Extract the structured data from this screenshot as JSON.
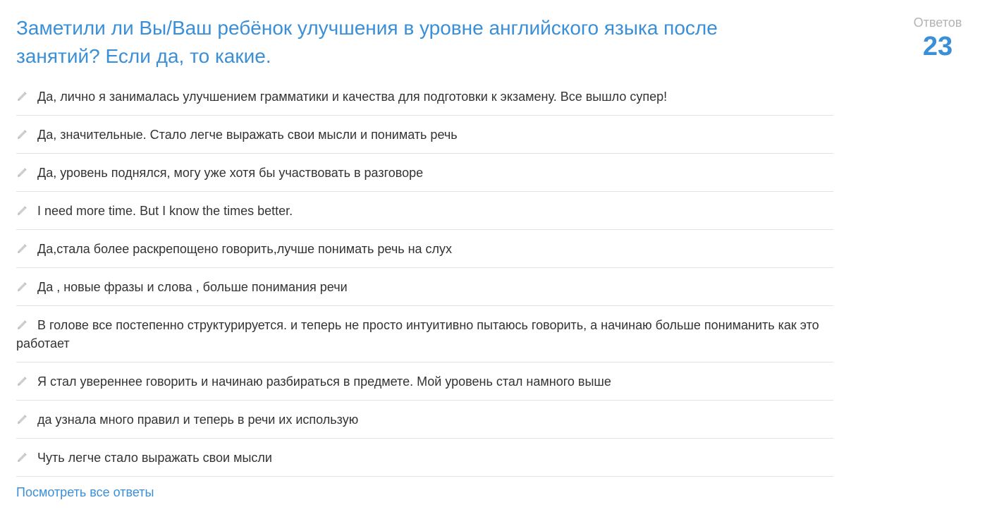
{
  "question": {
    "title": "Заметили ли Вы/Ваш ребёнок улучшения в уровне английского языка после занятий? Если да, то какие."
  },
  "stats": {
    "label": "Ответов",
    "count": "23"
  },
  "answers": [
    {
      "text": "Да, лично я занималась улучшением грамматики и качества для подготовки к экзамену. Все вышло супер!",
      "icon": "pencil-icon"
    },
    {
      "text": "Да, значительные. Стало легче выражать свои мысли и понимать речь",
      "icon": "pencil-icon"
    },
    {
      "text": "Да, уровень поднялся, могу уже хотя бы участвовать в разговоре",
      "icon": "pencil-icon"
    },
    {
      "text": "I need more time. But I know the times better.",
      "icon": "pencil-icon"
    },
    {
      "text": "Да,стала более раскрепощено говорить,лучше понимать речь на слух",
      "icon": "pencil-icon"
    },
    {
      "text": "Да , новые фразы и слова , больше понимания речи",
      "icon": "pencil-icon"
    },
    {
      "text": "В голове все постепенно структурируется. и теперь не просто интуитивно пытаюсь говорить, а начинаю больше пониманить как это работает",
      "icon": "pencil-icon"
    },
    {
      "text": "Я стал увереннее говорить и начинаю разбираться в предмете. Мой уровень стал намного выше",
      "icon": "pencil-icon"
    },
    {
      "text": "да узнала много правил и теперь в речи их использую",
      "icon": "pencil-icon"
    },
    {
      "text": "Чуть легче стало выражать свои мысли",
      "icon": "pencil-icon"
    }
  ],
  "footer": {
    "view_all_label": "Посмотреть все ответы"
  },
  "colors": {
    "accent": "#3b8fd6",
    "muted": "#b3b3b3",
    "text": "#333333",
    "divider": "#e3e3e3"
  }
}
